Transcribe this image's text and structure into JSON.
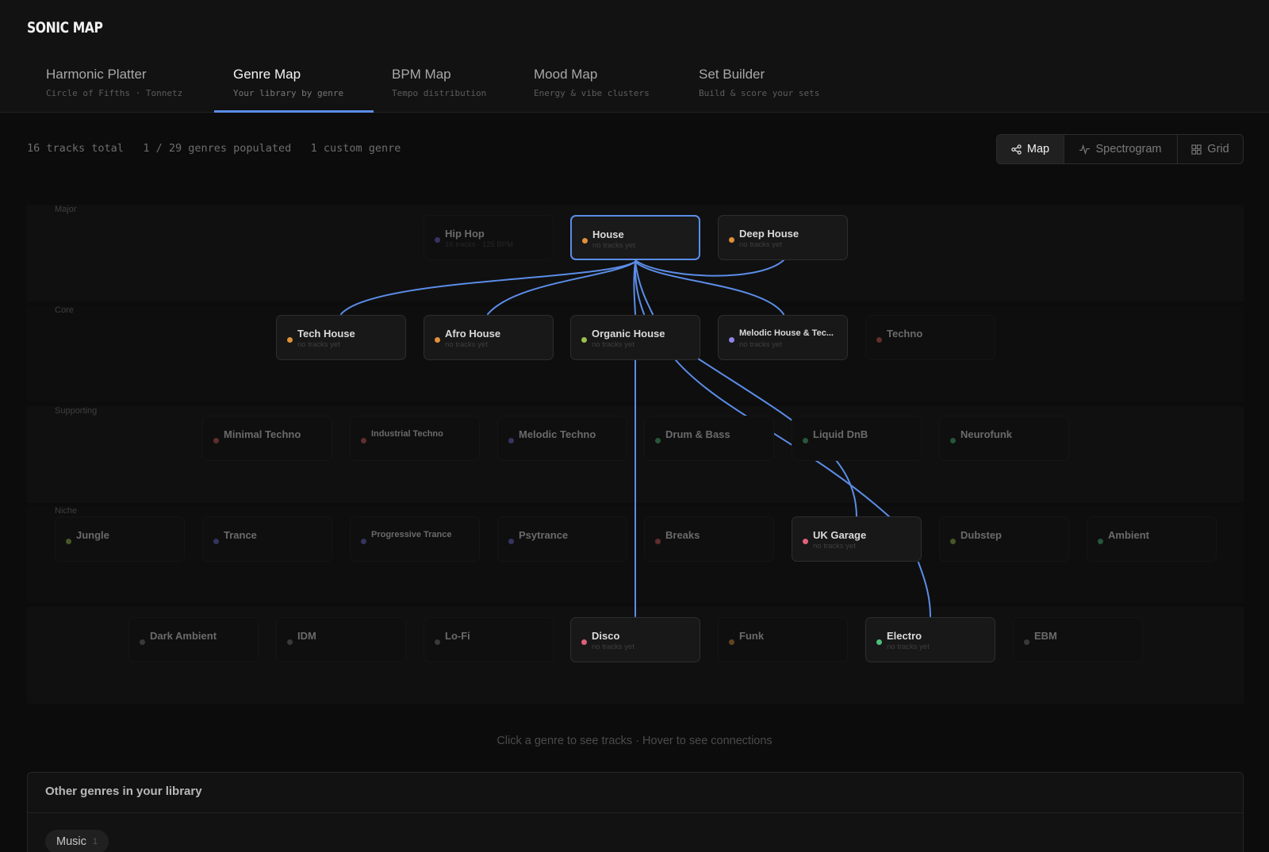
{
  "app": {
    "logo": "SONIC MAP"
  },
  "tabs": [
    {
      "title": "Harmonic Platter",
      "subtitle": "Circle of Fifths · Tonnetz"
    },
    {
      "title": "Genre Map",
      "subtitle": "Your library by genre",
      "active": true
    },
    {
      "title": "BPM Map",
      "subtitle": "Tempo distribution"
    },
    {
      "title": "Mood Map",
      "subtitle": "Energy & vibe clusters"
    },
    {
      "title": "Set Builder",
      "subtitle": "Build & score your sets"
    }
  ],
  "stats": {
    "tracks": "16 tracks total",
    "genres": "1 / 29 genres populated",
    "custom": "1 custom genre"
  },
  "view_toggle": {
    "map": "Map",
    "spectrogram": "Spectrogram",
    "grid": "Grid",
    "selected": "Map"
  },
  "tiers": [
    "Major",
    "Core",
    "Supporting",
    "Niche"
  ],
  "colors": {
    "accent": "#5b8de8"
  },
  "genres": {
    "hip_hop": {
      "name": "Hip Hop",
      "sub": "16 tracks · 125 BPM",
      "color": "#6b6fd6"
    },
    "house": {
      "name": "House",
      "sub": "no tracks yet",
      "color": "#e0903a"
    },
    "deep_house": {
      "name": "Deep House",
      "sub": "no tracks yet",
      "color": "#e0903a"
    },
    "tech_house": {
      "name": "Tech House",
      "sub": "no tracks yet",
      "color": "#e0903a"
    },
    "afro_house": {
      "name": "Afro House",
      "sub": "no tracks yet",
      "color": "#e0903a"
    },
    "organic_house": {
      "name": "Organic House",
      "sub": "no tracks yet",
      "color": "#9cc24a"
    },
    "melodic_house_tech": {
      "name": "Melodic House & Tec...",
      "sub": "no tracks yet",
      "color": "#8f83e8"
    },
    "techno": {
      "name": "Techno",
      "sub": "",
      "color": "#e05a5a"
    },
    "minimal_techno": {
      "name": "Minimal Techno",
      "sub": "",
      "color": "#e05a5a"
    },
    "industrial_techno": {
      "name": "Industrial Techno",
      "sub": "",
      "color": "#e05a5a"
    },
    "melodic_techno": {
      "name": "Melodic Techno",
      "sub": "",
      "color": "#6b6fd6"
    },
    "drum_bass": {
      "name": "Drum & Bass",
      "sub": "",
      "color": "#4cc07a"
    },
    "liquid_dnb": {
      "name": "Liquid DnB",
      "sub": "",
      "color": "#4cc07a"
    },
    "neurofunk": {
      "name": "Neurofunk",
      "sub": "",
      "color": "#4cc07a"
    },
    "jungle": {
      "name": "Jungle",
      "sub": "",
      "color": "#9cc24a"
    },
    "trance": {
      "name": "Trance",
      "sub": "",
      "color": "#6b6fd6"
    },
    "progressive_trance": {
      "name": "Progressive Trance",
      "sub": "",
      "color": "#6b6fd6"
    },
    "psytrance": {
      "name": "Psytrance",
      "sub": "",
      "color": "#6b6fd6"
    },
    "breaks": {
      "name": "Breaks",
      "sub": "",
      "color": "#e05a5a"
    },
    "uk_garage": {
      "name": "UK Garage",
      "sub": "no tracks yet",
      "color": "#e0607a"
    },
    "dubstep": {
      "name": "Dubstep",
      "sub": "",
      "color": "#9cc24a"
    },
    "ambient": {
      "name": "Ambient",
      "sub": "",
      "color": "#4cc07a"
    },
    "dark_ambient": {
      "name": "Dark Ambient",
      "sub": "",
      "color": "#777777"
    },
    "idm": {
      "name": "IDM",
      "sub": "",
      "color": "#777777"
    },
    "lofi": {
      "name": "Lo-Fi",
      "sub": "",
      "color": "#777777"
    },
    "disco": {
      "name": "Disco",
      "sub": "no tracks yet",
      "color": "#e0607a"
    },
    "funk": {
      "name": "Funk",
      "sub": "",
      "color": "#e0903a"
    },
    "electro": {
      "name": "Electro",
      "sub": "no tracks yet",
      "color": "#4cc07a"
    },
    "ebm": {
      "name": "EBM",
      "sub": "",
      "color": "#777777"
    }
  },
  "hint": "Click a genre to see tracks · Hover to see connections",
  "other_genres": {
    "title": "Other genres in your library",
    "chips": [
      {
        "label": "Music",
        "count": "1"
      }
    ]
  }
}
